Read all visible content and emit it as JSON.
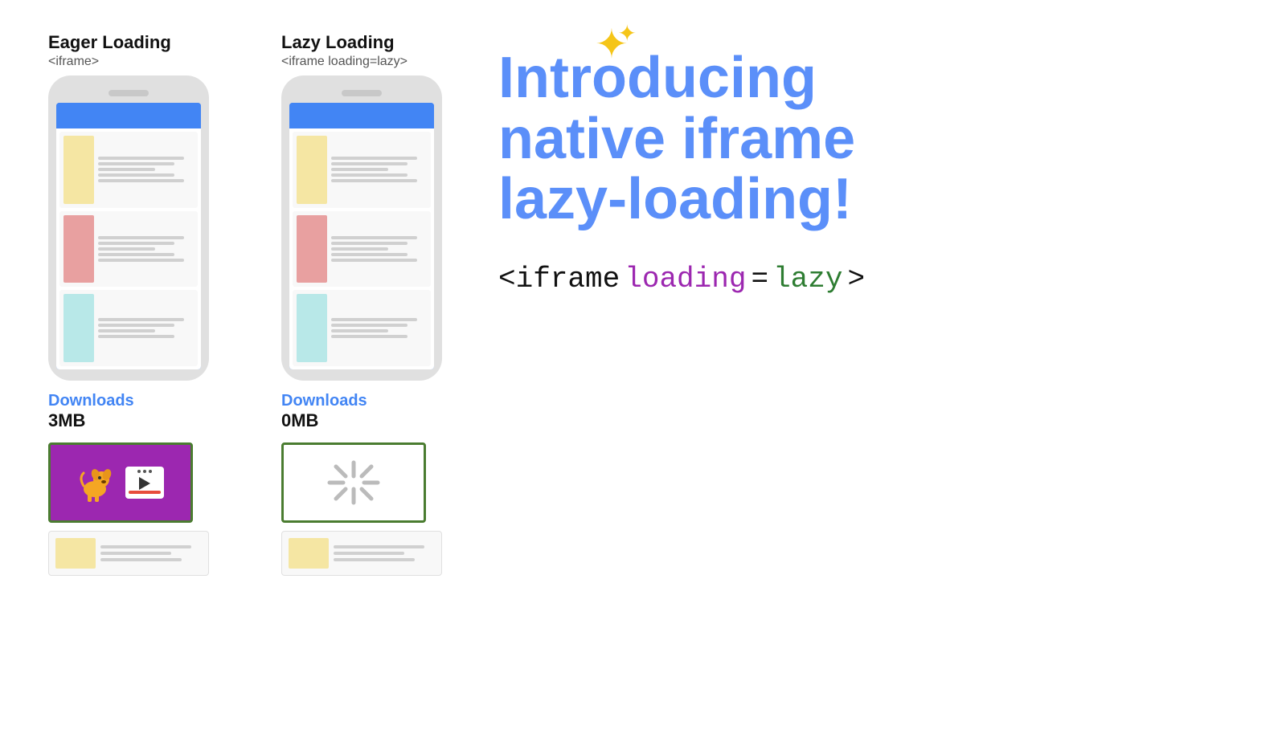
{
  "eager": {
    "title": "Eager Loading",
    "subtitle": "<iframe>",
    "downloads_label": "Downloads",
    "downloads_size": "3MB"
  },
  "lazy": {
    "title": "Lazy Loading",
    "subtitle": "<iframe loading=lazy>",
    "downloads_label": "Downloads",
    "downloads_size": "0MB"
  },
  "intro": {
    "heading_line1": "Introducing",
    "heading_line2": "native iframe",
    "heading_line3": "lazy-loading!",
    "code_part1": "<iframe",
    "code_part2": "loading",
    "code_part3": "=",
    "code_part4": "lazy",
    "code_part5": ">"
  },
  "colors": {
    "blue": "#4285f4",
    "heading_blue": "#5b8ff9",
    "purple": "#9c27b0",
    "green": "#2e7d32"
  }
}
